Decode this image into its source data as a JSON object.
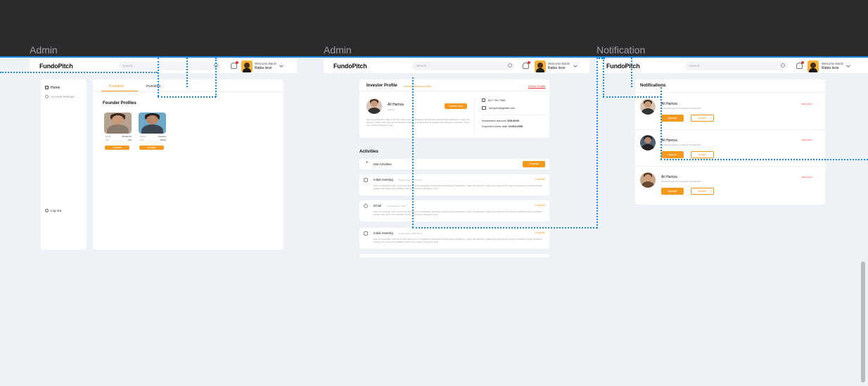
{
  "frames": [
    {
      "label": "Admin"
    },
    {
      "label": "Admin"
    },
    {
      "label": "Notification"
    }
  ],
  "brand": {
    "logo": "FundoPitch",
    "search_placeholder": "Search...",
    "welcome": "Welcome Back!",
    "user_name": "Rabia Israr"
  },
  "admin": {
    "sidebar": {
      "home": "Home",
      "account_settings": "Account Settings",
      "logout": "Log out"
    },
    "tabs": [
      "Founders",
      "Investors"
    ],
    "section_title": "Founder Profiles",
    "profiles": [
      {
        "label1": "Name",
        "value1": "Ali Hamza",
        "label2": "City",
        "value2": "Kiel",
        "button": "Contact"
      },
      {
        "label1": "Name",
        "value1": "Ameena",
        "label2": "City",
        "value2": "Abbott",
        "button": "Contact"
      }
    ]
  },
  "investor": {
    "title": "Investor Profile",
    "breadcrumb": "Home/ Investor profile",
    "delete": "Delete Profile",
    "name": "Ali Hamza",
    "role": "Investor",
    "contact_button": "Contact Now",
    "bio": "Quis ut perspiciatis unde omnis iste natus error sit voluptatem accusantium doloremque laudantium, totam rem aperiam, eaque ipsa quae ab illo inventore veritatis et quasi architecto beatae vitae dicta sunt explicabo. Nemo enim ipsam voluptatem quia.",
    "phone": "847 793 7085",
    "email": "lundyvin@gmail.com",
    "investment_label": "Investment amount:",
    "investment_value": "$35.0000",
    "close_label": "Expected close date:",
    "close_value": "02/01/2000",
    "activities_title": "Activities",
    "add_activities": "Add Activities",
    "add_button": "Complete",
    "activities": [
      {
        "title": "Initial meeting",
        "meta": "Created date: 2023-10-18",
        "status": "Complete",
        "text": "Sed ut perspiciatis unde omnis iste natus error sit voluptatem accusantium doloremque laudantium, totam rem aperiam, eaque ipsa quae ab illo inventore veritatis et quasi architecto beatae vitae dicta sunt explicabo. Nemo enim ipsam voluptatem quia."
      },
      {
        "title": "Email",
        "meta": "Created date: 2023",
        "status": "Complete",
        "text": "Sed ut perspiciatis unde omnis iste natus error sit voluptatem accusantium doloremque laudantium, totam rem aperiam, eaque ipsa quae ab illo inventore veritatis et quasi architecto beatae vitae dicta sunt explicabo. Nemo enim ipsam voluptatem quia."
      },
      {
        "title": "Initial meeting",
        "meta": "Created date: 2023-10-18",
        "status": "Complete",
        "text": "Sed ut perspiciatis unde omnis iste natus error sit voluptatem accusantium doloremque laudantium, totam rem aperiam, eaque ipsa quae ab illo inventore veritatis et quasi architecto beatae vitae dicta sunt explicabo. Nemo enim ipsam voluptatem quia."
      }
    ]
  },
  "notifications": {
    "title": "Notifications",
    "items": [
      {
        "name": "Ali Hamza",
        "text": "Ali Hamza wants to untapper of fundopitch",
        "date": "2023-06-01",
        "approve": "Approve",
        "decline": "Decline"
      },
      {
        "name": "Ali Hamza",
        "text": "Ali Hamza wants to untapper of fundopitch",
        "date": "2023-06-01",
        "approve": "Approve",
        "decline": "Decline"
      },
      {
        "name": "Ali Hamza",
        "text": "Ali Hamza wants to untapper of fundopitch",
        "date": "2023-06-01",
        "approve": "Approve",
        "decline": "Decline"
      }
    ]
  },
  "colors": {
    "accent": "#f39a1e",
    "selection": "#1e88e5",
    "dark": "#2b2b2b",
    "canvas": "#eef1f5"
  },
  "icons": [
    "home-icon",
    "gear-icon",
    "logout-icon",
    "search-icon",
    "bell-icon",
    "chevron-down-icon",
    "phone-icon",
    "mail-icon",
    "plus-icon",
    "calendar-icon"
  ]
}
